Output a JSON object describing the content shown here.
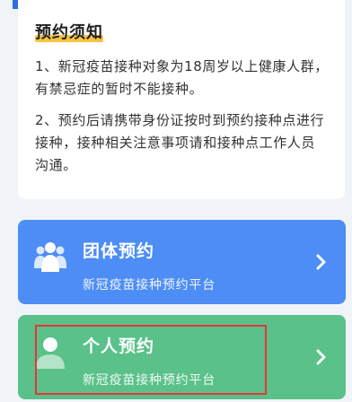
{
  "notice": {
    "title": "预约须知",
    "paragraphs": [
      "1、新冠疫苗接种对象为18周岁以上健康人群，有禁忌症的暂时不能接种。",
      "2、预约后请携带身份证按时到预约接种点进行接种，接种相关注意事项请和接种点工作人员沟通。"
    ]
  },
  "buttons": {
    "group": {
      "title": "团体预约",
      "subtitle": "新冠疫苗接种预约平台",
      "icon": "group-people-icon",
      "color": "#4d8df5"
    },
    "personal": {
      "title": "个人预约",
      "subtitle": "新冠疫苗接种预约平台",
      "icon": "person-icon",
      "color": "#59c189"
    }
  },
  "colors": {
    "page_bg": "#f0f3f8",
    "title_highlight": "#f6c343",
    "annotation_box": "#e8343a"
  }
}
